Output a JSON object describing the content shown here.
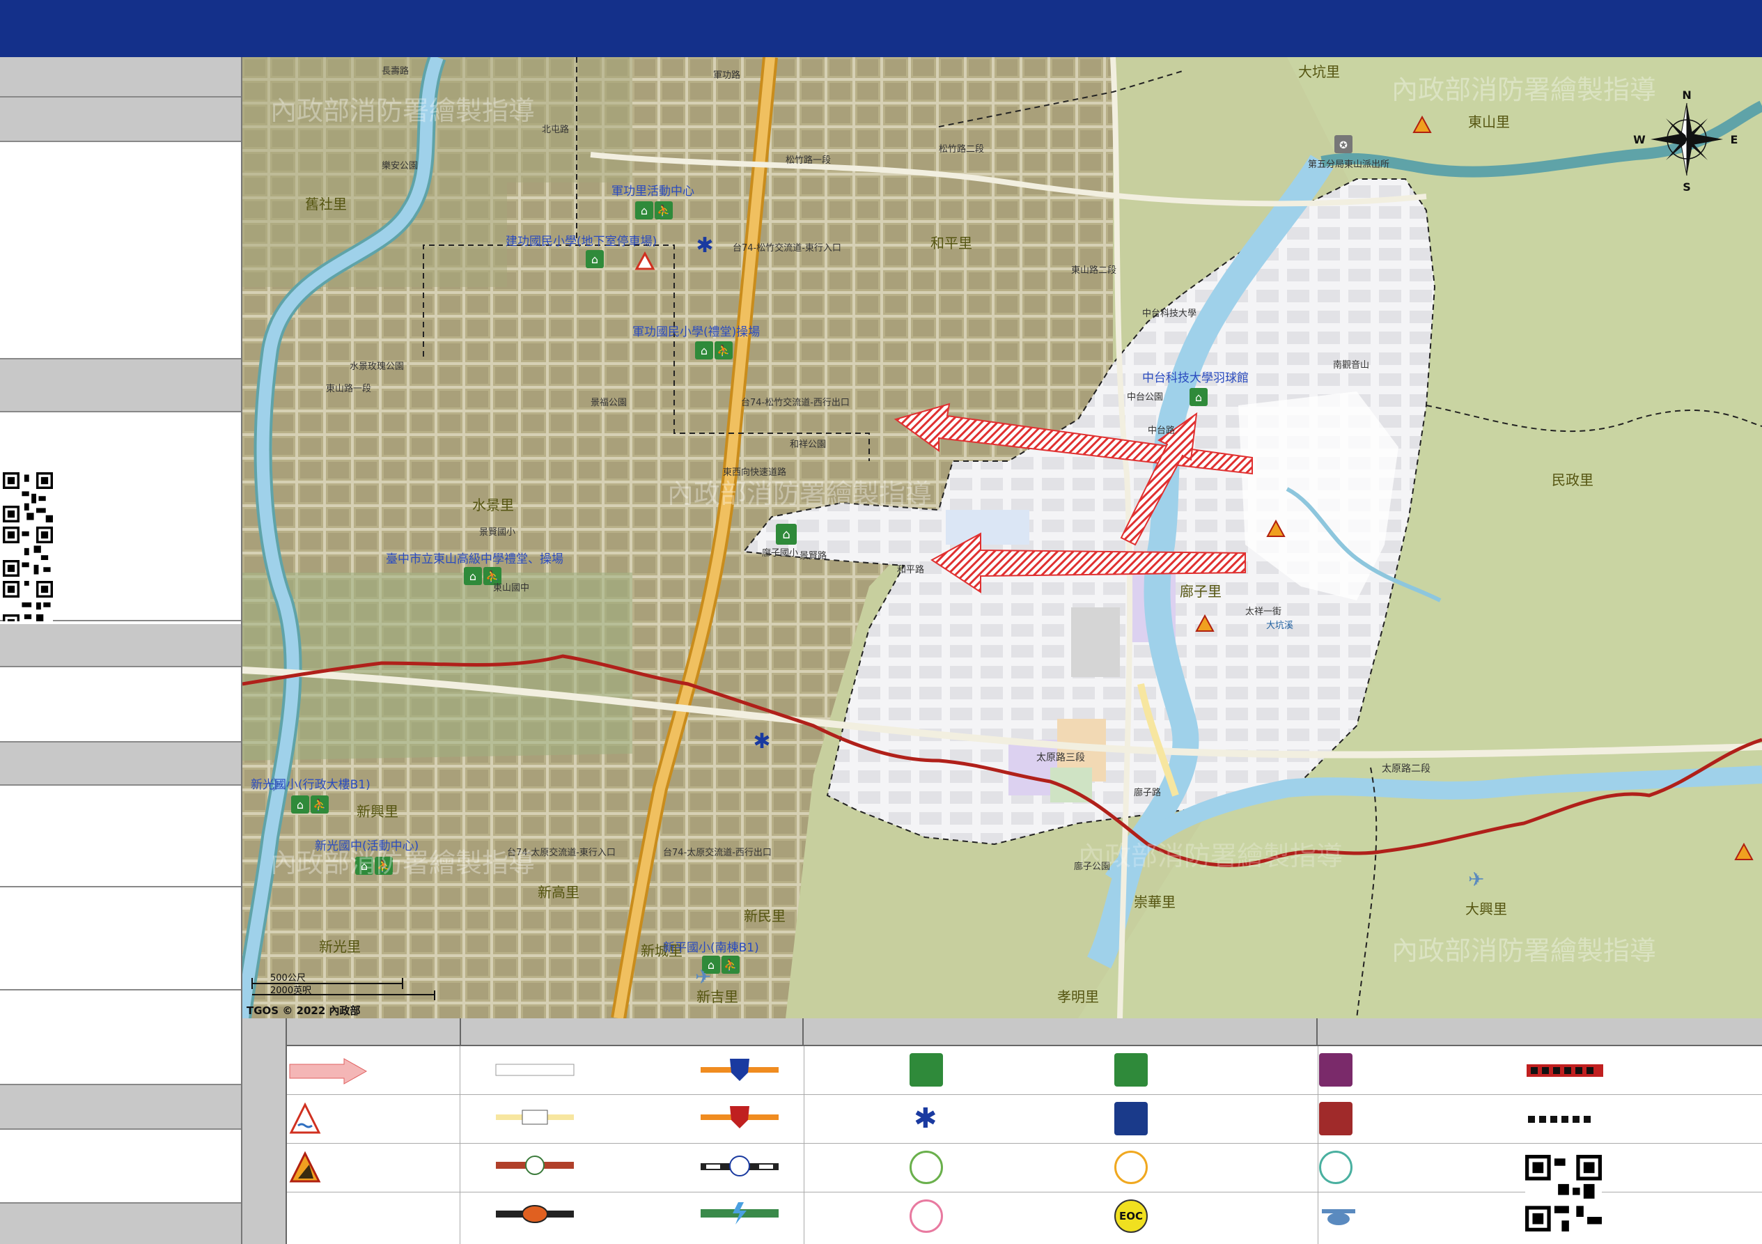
{
  "header": {
    "title": ""
  },
  "colors": {
    "header": "#14308a",
    "panel_gray": "#c8c8c8",
    "river": "#9fd1ea",
    "boundary_red": "#b0201a",
    "evacuation_arrow": "#e03030",
    "highway": "#e8a82c",
    "terrain": "#c7cf9e",
    "urban": "#b9b08a",
    "shelter_green": "#2f8a3a"
  },
  "map": {
    "compass": {
      "n": "N",
      "s": "S",
      "e": "E",
      "w": "W"
    },
    "watermarks": [
      "內政部消防署繪製指導",
      "內政部消防署繪製指導",
      "內政部消防署繪製指導",
      "內政部消防署繪製指導",
      "內政部消防署繪製指導",
      "內政部消防署繪製指導"
    ],
    "copyright": "TGOS © 2022 內政部",
    "scale": {
      "label1": "500公尺",
      "label2": "2000英呎"
    },
    "villages": [
      "舊社里",
      "和平里",
      "水景里",
      "廍子里",
      "新興里",
      "新高里",
      "新城里",
      "新光里",
      "新吉里",
      "東山里",
      "民政里",
      "大坑里",
      "大興里",
      "崇華里",
      "孝明里",
      "新民里"
    ],
    "shelters": [
      "軍功里活動中心",
      "建功國民小學(地下室停車場)",
      "軍功國民小學(禮堂)操場",
      "中台科技大學羽球館",
      "臺中市立東山高級中學禮堂、操場",
      "新光國小(行政大樓B1)",
      "新光國中(活動中心)",
      "新平國小(南棟B1)",
      "廍子國小"
    ],
    "streets": [
      "長壽路",
      "太原路三段",
      "太原路二段",
      "東山路一段",
      "東山路二段",
      "松竹路一段",
      "松竹路二段",
      "北屯路",
      "軍功路",
      "和平路",
      "太祥一街",
      "景賢路",
      "廍子路",
      "東西向快速道路",
      "中台路",
      "大坑溪"
    ],
    "places": [
      "中台科技大學",
      "中台公園",
      "和祥公園",
      "水景玫瑰公園",
      "第五分局東山派出所",
      "南觀音山",
      "景福公園",
      "廍子公園",
      "東山國中",
      "景賢國小",
      "樂安公園",
      "台74-松竹交流道-西行出口",
      "台74-松竹交流道-東行入口",
      "台74-太原交流道-東行入口",
      "台74-太原交流道-西行出口"
    ]
  },
  "legend": {
    "headers": [
      "",
      "",
      "",
      "",
      ""
    ],
    "items": [
      {
        "icon": "evacuation-arrow",
        "label": ""
      },
      {
        "icon": "road-white",
        "label": ""
      },
      {
        "icon": "police-shield-blue",
        "label": ""
      },
      {
        "icon": "outdoor-shelter",
        "label": ""
      },
      {
        "icon": "indoor-shelter",
        "label": ""
      },
      {
        "icon": "government-building",
        "label": ""
      },
      {
        "icon": "red-dashed-boundary",
        "label": ""
      },
      {
        "icon": "flood-warning",
        "label": ""
      },
      {
        "icon": "road-yellow",
        "label": ""
      },
      {
        "icon": "fire-shield-red",
        "label": ""
      },
      {
        "icon": "medical-star",
        "label": ""
      },
      {
        "icon": "police-station",
        "label": ""
      },
      {
        "icon": "fire-station",
        "label": ""
      },
      {
        "icon": "black-dashed-boundary",
        "label": ""
      },
      {
        "icon": "landslide-warning",
        "label": ""
      },
      {
        "icon": "highway-shield",
        "label": ""
      },
      {
        "icon": "railway",
        "label": ""
      },
      {
        "icon": "wheelchair",
        "label": ""
      },
      {
        "icon": "elderly",
        "label": ""
      },
      {
        "icon": "infant-care",
        "label": ""
      },
      {
        "icon": "legend-qr",
        "label": ""
      },
      {
        "icon": "local-road",
        "label": ""
      },
      {
        "icon": "power-line",
        "label": ""
      },
      {
        "icon": "women-care",
        "label": ""
      },
      {
        "icon": "eoc",
        "label": "EOC"
      },
      {
        "icon": "helicopter",
        "label": ""
      }
    ]
  },
  "sidebar": {
    "sections": [
      "",
      "",
      "",
      "",
      "",
      "",
      "",
      ""
    ]
  }
}
